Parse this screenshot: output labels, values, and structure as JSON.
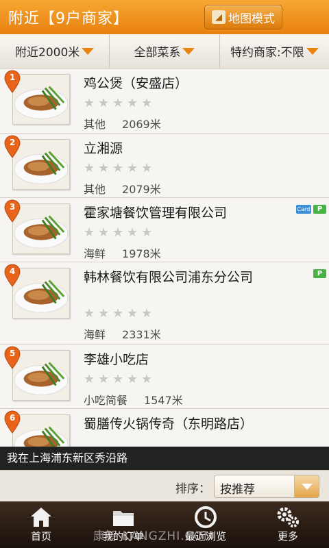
{
  "header": {
    "title": "附近【9户商家】",
    "map_button_label": "地图模式"
  },
  "filters": [
    {
      "label": "附近2000米"
    },
    {
      "label": "全部菜系"
    },
    {
      "label": "特约商家:不限"
    }
  ],
  "rows": [
    {
      "index": "1",
      "name": "鸡公煲（安盛店）",
      "category": "其他",
      "distance": "2069米",
      "rating": 0,
      "badges": []
    },
    {
      "index": "2",
      "name": "立湘源",
      "category": "其他",
      "distance": "2079米",
      "rating": 0,
      "badges": []
    },
    {
      "index": "3",
      "name": "霍家塘餐饮管理有限公司",
      "category": "海鲜",
      "distance": "1978米",
      "rating": 0,
      "badges": [
        "Card",
        "P"
      ]
    },
    {
      "index": "4",
      "name": "韩林餐饮有限公司浦东分公司",
      "category": "海鲜",
      "distance": "2331米",
      "rating": 0,
      "badges": [
        "P"
      ]
    },
    {
      "index": "5",
      "name": "李雄小吃店",
      "category": "小吃简餐",
      "distance": "1547米",
      "rating": 0,
      "badges": []
    },
    {
      "index": "6",
      "name": "蜀膳传火锅传奇（东明路店）",
      "category": "",
      "distance": "",
      "rating": 0,
      "badges": []
    }
  ],
  "location": {
    "text": "我在上海浦东新区秀沿路"
  },
  "sort": {
    "label": "排序：",
    "value": "按推荐"
  },
  "nav": [
    {
      "label": "首页",
      "icon": "home-icon"
    },
    {
      "label": "我的订单",
      "icon": "folder-icon"
    },
    {
      "label": "最近浏览",
      "icon": "history-icon"
    },
    {
      "label": "更多",
      "icon": "gears-icon"
    }
  ],
  "watermark": "康智 KANGZHI.COM",
  "colors": {
    "header": "#e8800f",
    "accent": "#e9850f",
    "pin": "#e8641a",
    "nav_bg": "#2a1c13"
  }
}
